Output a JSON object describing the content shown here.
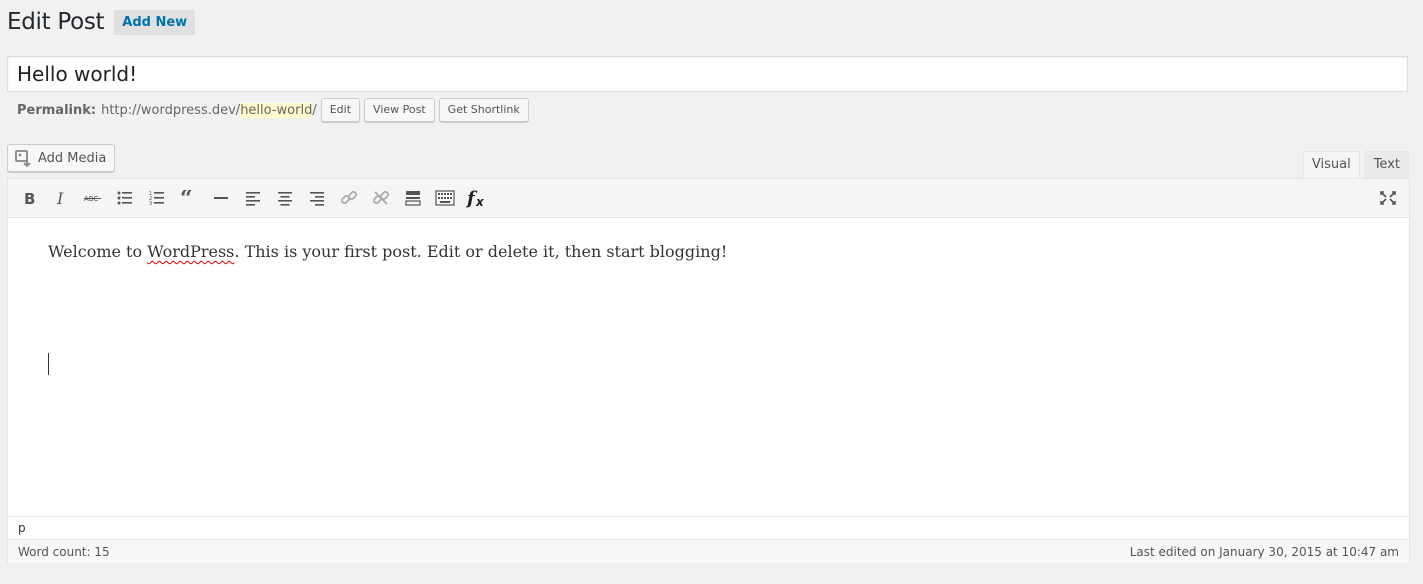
{
  "header": {
    "title": "Edit Post",
    "add_new_label": "Add New"
  },
  "post": {
    "title_value": "Hello world!"
  },
  "permalink": {
    "label": "Permalink:",
    "base_url": "http://wordpress.dev/",
    "slug": "hello-world",
    "trailing": "/",
    "buttons": {
      "edit": "Edit",
      "view": "View Post",
      "shortlink": "Get Shortlink"
    }
  },
  "media": {
    "add_media_label": "Add Media"
  },
  "editor_tabs": {
    "visual": "Visual",
    "text": "Text",
    "active": "Visual"
  },
  "toolbar": {
    "buttons": [
      "bold-icon",
      "italic-icon",
      "strikethrough-icon",
      "bulleted-list-icon",
      "numbered-list-icon",
      "blockquote-icon",
      "horizontal-line-icon",
      "align-left-icon",
      "align-center-icon",
      "align-right-icon",
      "insert-link-icon",
      "remove-link-icon",
      "read-more-icon",
      "toolbar-toggle-icon",
      "clear-formatting-icon",
      "fullscreen-icon"
    ]
  },
  "content": {
    "before_spell": "Welcome to ",
    "misspelled": "WordPress",
    "after_spell": ". This is your first post. Edit or delete it, then start blogging!"
  },
  "path_bar": {
    "path": "p"
  },
  "status_bar": {
    "word_count": "Word count: 15",
    "last_edited": "Last edited on January 30, 2015 at 10:47 am"
  }
}
